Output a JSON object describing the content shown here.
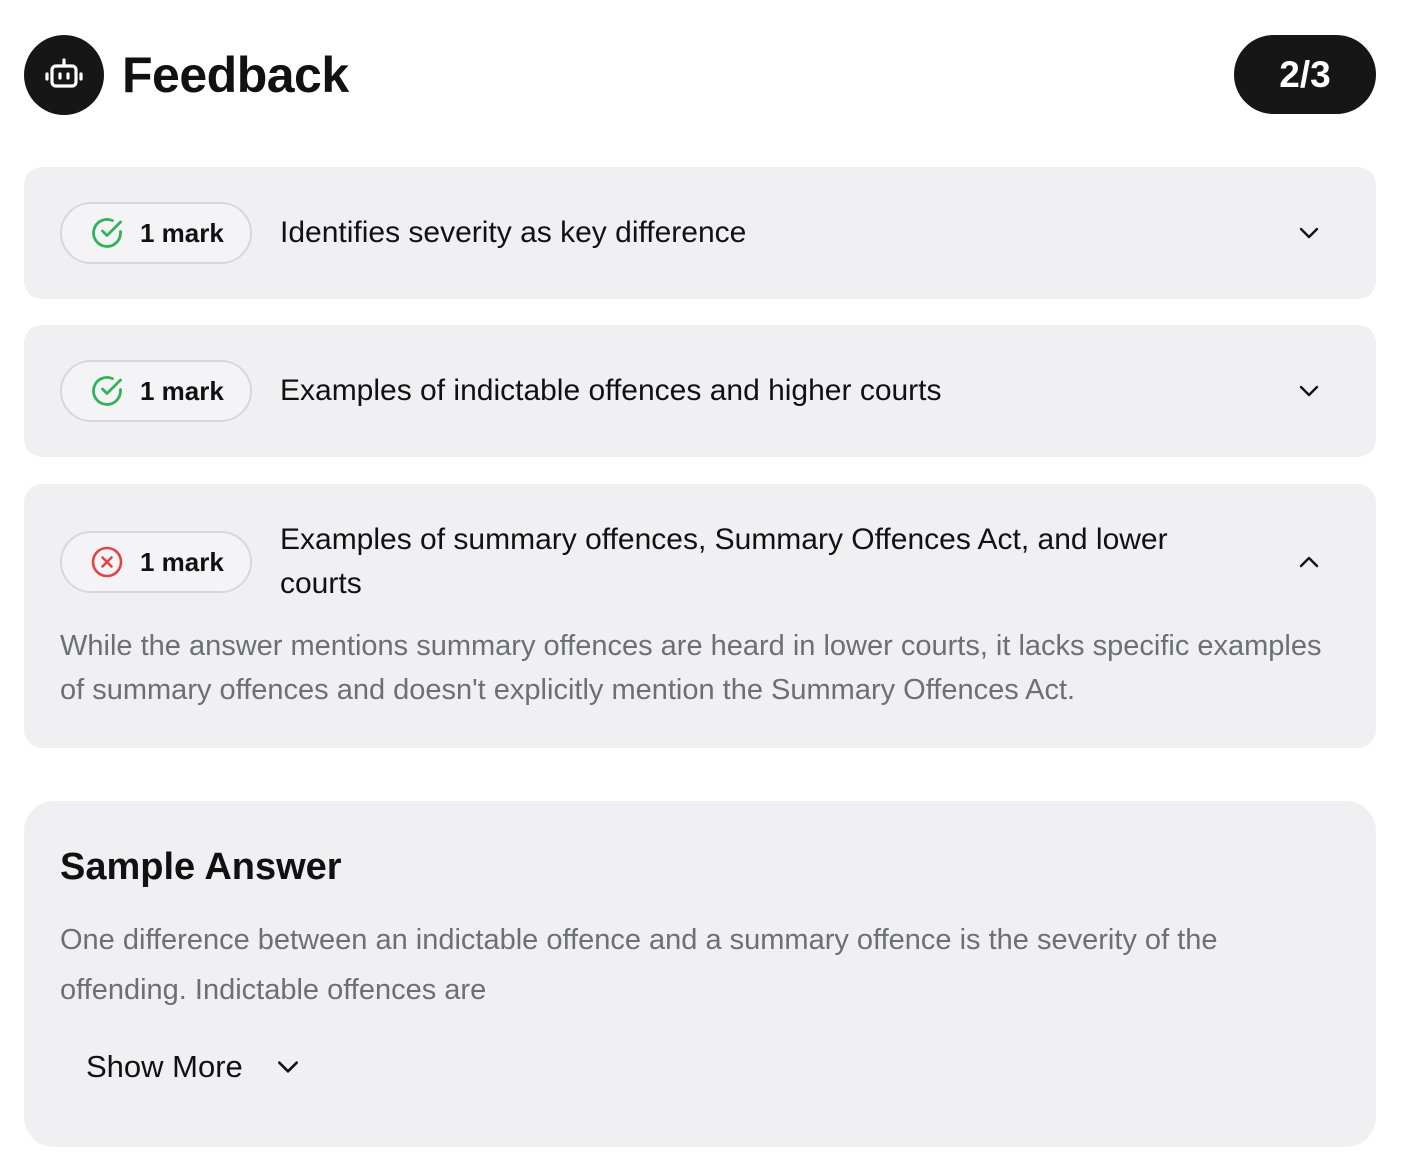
{
  "header": {
    "title": "Feedback",
    "score": "2/3",
    "avatar_icon": "robot-icon"
  },
  "criteria": [
    {
      "mark": "1 mark",
      "status": "correct",
      "status_icon": "check-circle-icon",
      "text": "Identifies severity as key difference",
      "expanded": false
    },
    {
      "mark": "1 mark",
      "status": "correct",
      "status_icon": "check-circle-icon",
      "text": "Examples of indictable offences and higher courts",
      "expanded": false
    },
    {
      "mark": "1 mark",
      "status": "incorrect",
      "status_icon": "x-circle-icon",
      "text": "Examples of summary offences, Summary Offences Act, and lower courts",
      "expanded": true,
      "detail": "While the answer mentions summary offences are heard in lower courts, it lacks specific examples of summary offences and doesn't explicitly mention the Summary Offences Act."
    }
  ],
  "sample_answer": {
    "title": "Sample Answer",
    "text": "One difference between an indictable offence and a summary offence is the severity of the offending. Indictable offences are",
    "show_more_label": "Show More"
  },
  "colors": {
    "correct": "#2fb45a",
    "incorrect": "#e0454a",
    "card_bg": "#f0f0f2",
    "dark": "#161616",
    "muted_text": "#6e6e76"
  }
}
